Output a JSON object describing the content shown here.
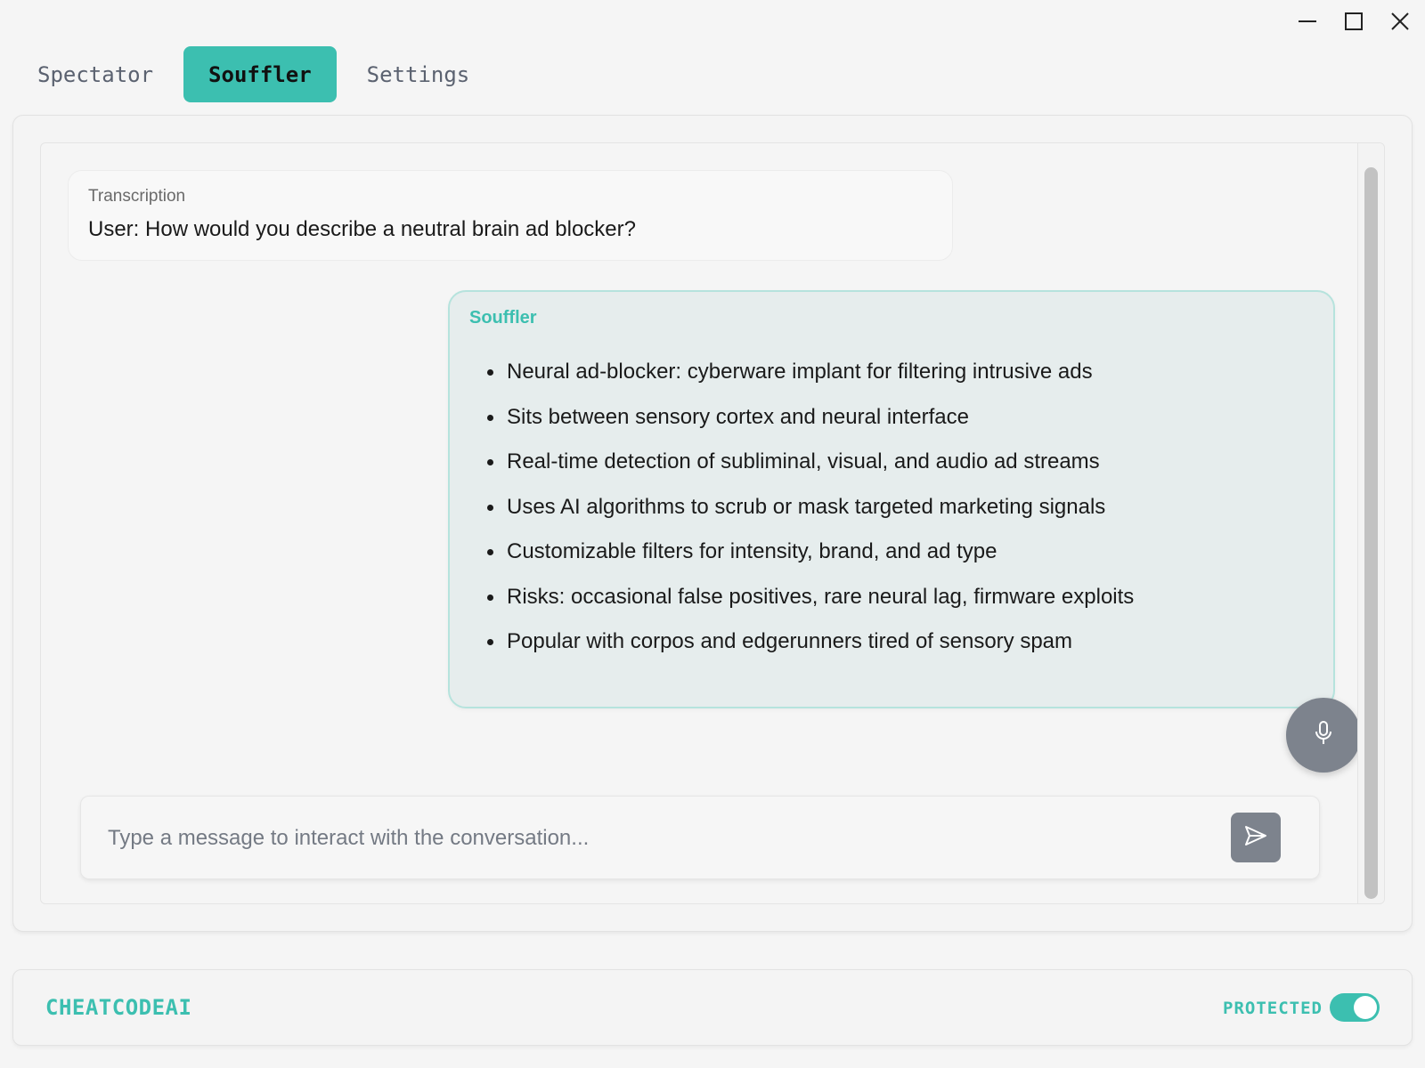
{
  "tabs": [
    {
      "label": "Spectator",
      "active": false
    },
    {
      "label": "Souffler",
      "active": true
    },
    {
      "label": "Settings",
      "active": false
    }
  ],
  "window_controls": [
    "minimize-icon",
    "maximize-icon",
    "close-icon"
  ],
  "transcription": {
    "label": "Transcription",
    "text": "User: How would you describe a neutral brain ad blocker?"
  },
  "answer": {
    "label": "Souffler",
    "items": [
      "Neural ad-blocker: cyberware implant for filtering intrusive ads",
      "Sits between sensory cortex and neural interface",
      "Real-time detection of subliminal, visual, and audio ad streams",
      "Uses AI algorithms to scrub or mask targeted marketing signals",
      "Customizable filters for intensity, brand, and ad type",
      "Risks: occasional false positives, rare neural lag, firmware exploits",
      "Popular with corpos and edgerunners tired of sensory spam"
    ]
  },
  "composer": {
    "placeholder": "Type a message to interact with the conversation...",
    "value": ""
  },
  "footer": {
    "brand": "CHEATCODEAI",
    "protected_label": "PROTECTED",
    "protected_on": true
  },
  "colors": {
    "accent": "#3cbfb0",
    "answer_bg": "#e6eded",
    "answer_border": "#b6e3dd",
    "button_gray": "#7d838d",
    "background": "#f5f5f5"
  }
}
